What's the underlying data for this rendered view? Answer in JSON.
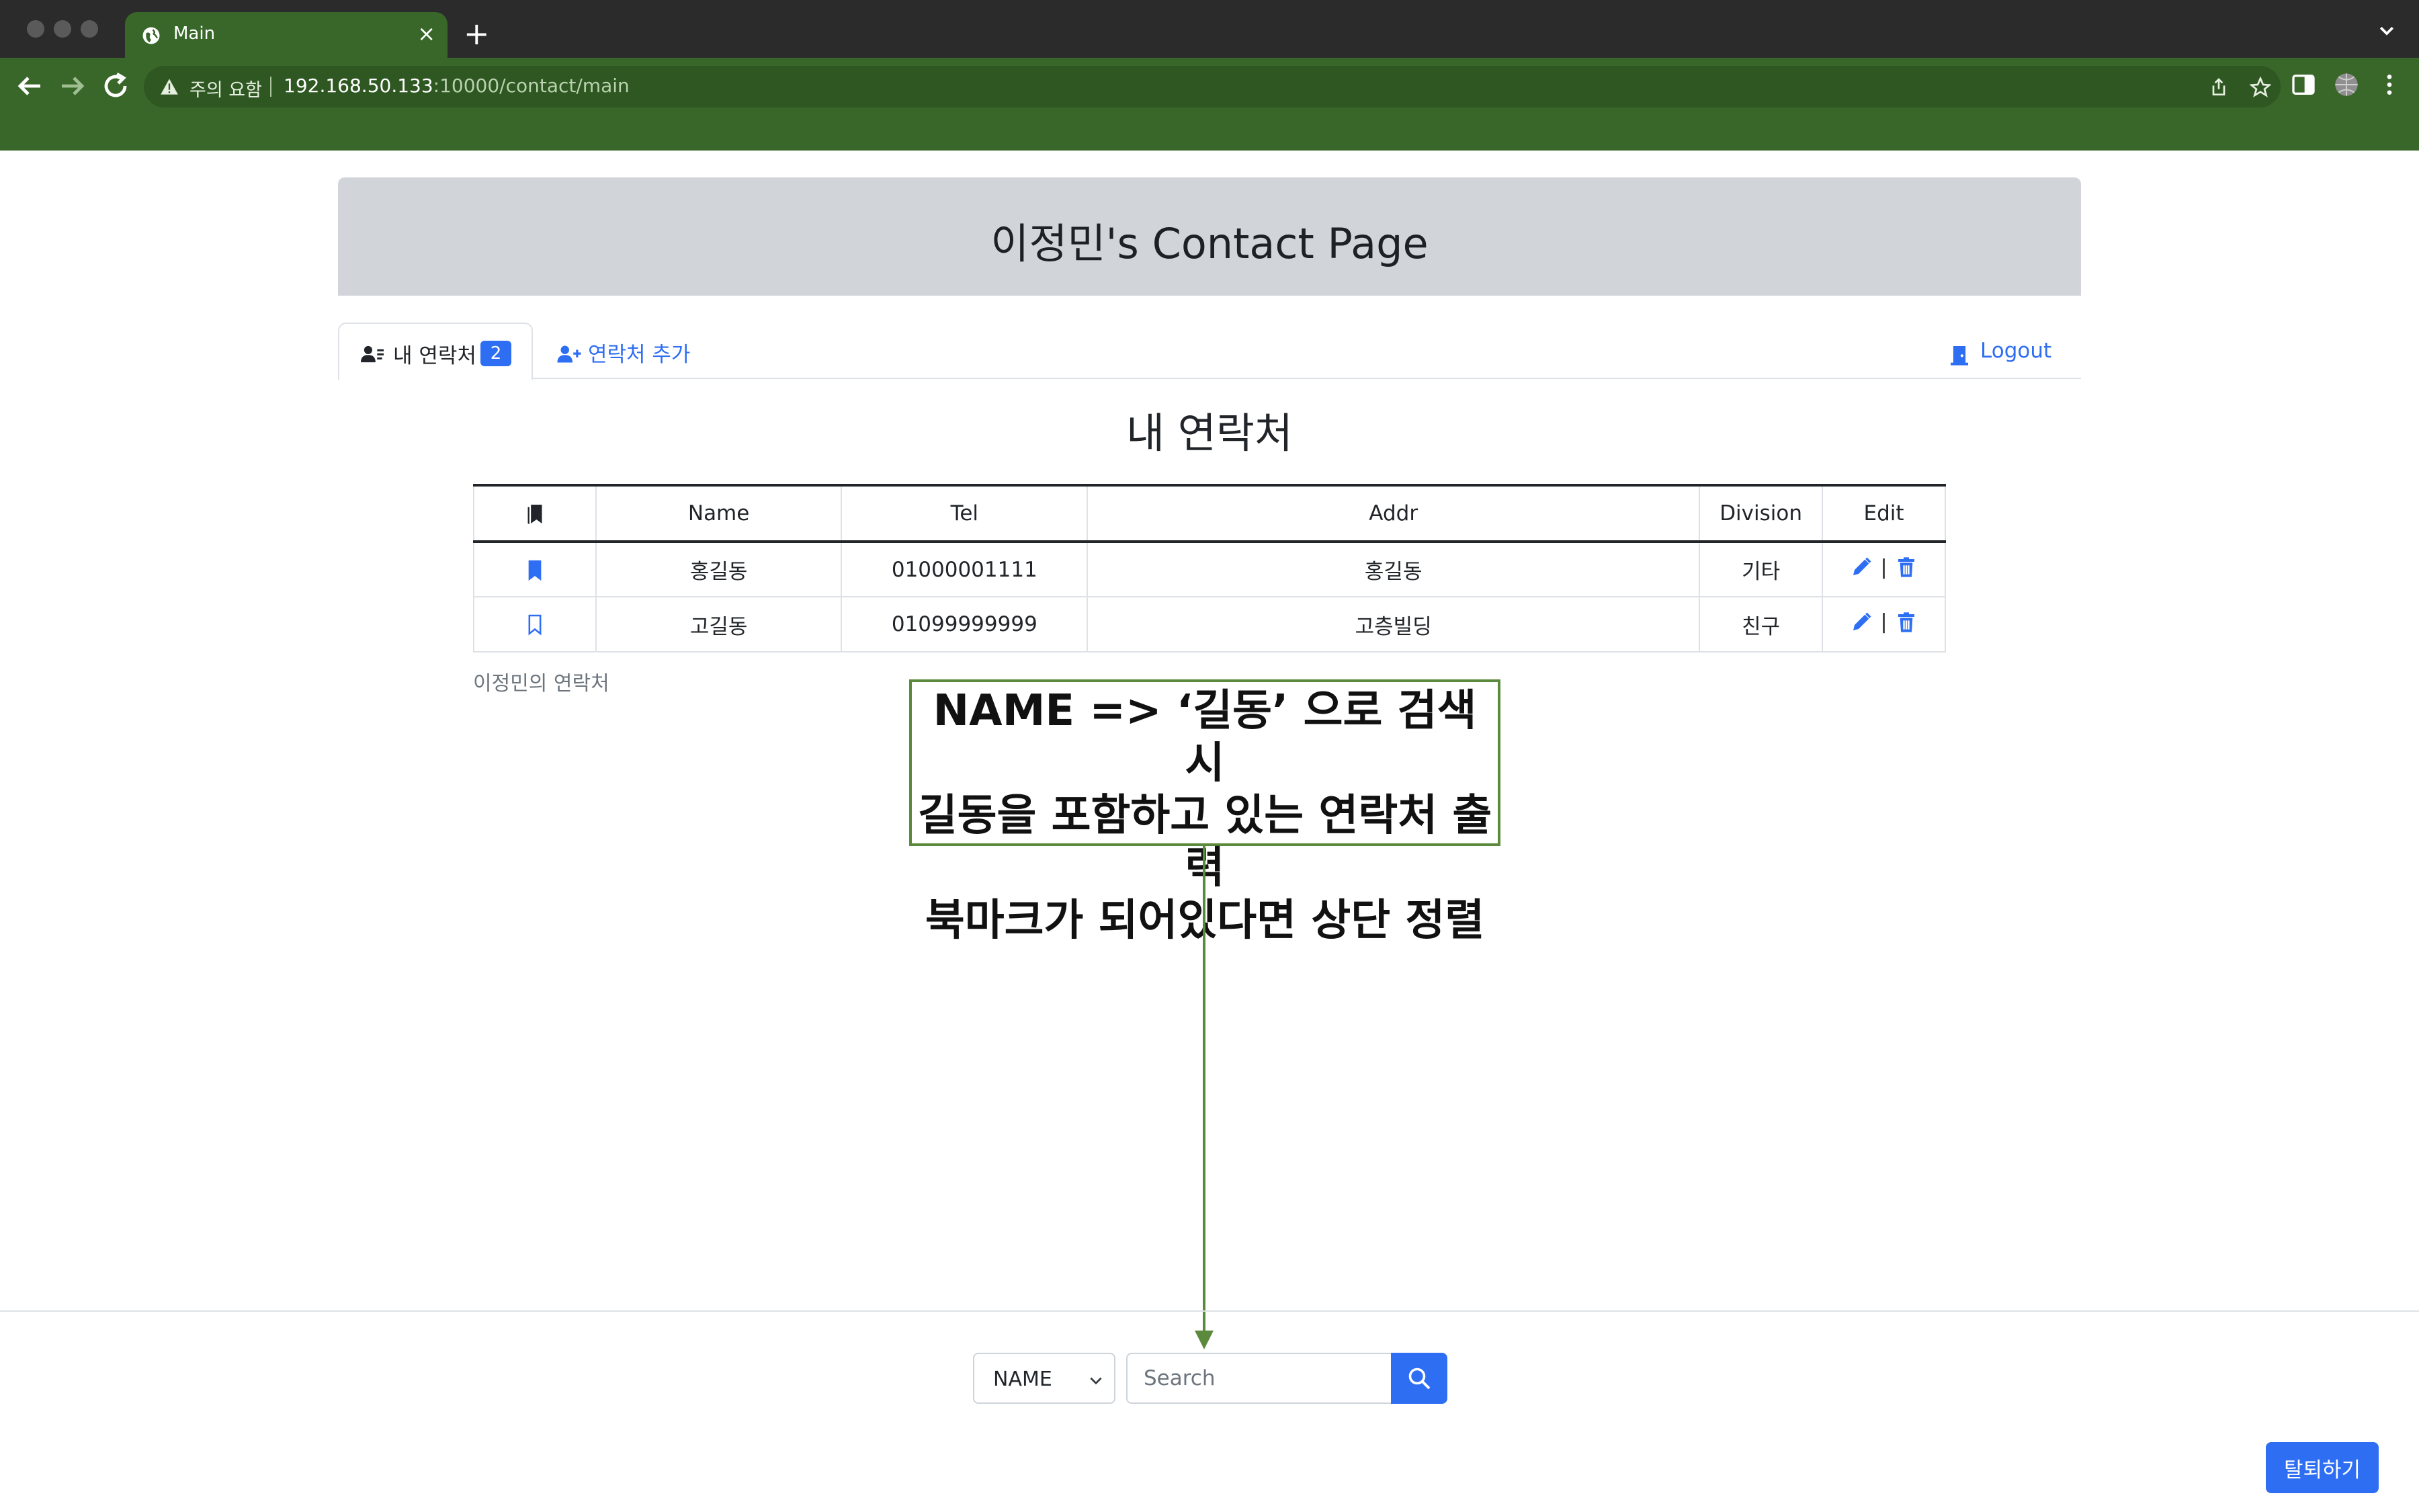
{
  "browser": {
    "tab_title": "Main",
    "new_tab": "+",
    "close_tab": "×",
    "security_warning": "주의 요함",
    "url_host": "192.168.50.133",
    "url_path": ":10000/contact/main"
  },
  "page": {
    "header_title": "이정민's Contact Page",
    "tabs": {
      "my_contacts": "내 연락처",
      "my_contacts_count": "2",
      "add_contact": "연락처 추가",
      "logout": "Logout"
    },
    "section_title": "내 연락처",
    "table": {
      "columns": [
        "",
        "Name",
        "Tel",
        "Addr",
        "Division",
        "Edit"
      ],
      "rows": [
        {
          "bookmarked": true,
          "name": "홍길동",
          "tel": "01000001111",
          "addr": "홍길동",
          "division": "기타"
        },
        {
          "bookmarked": false,
          "name": "고길동",
          "tel": "01099999999",
          "addr": "고층빌딩",
          "division": "친구"
        }
      ],
      "edit_separator": "|"
    },
    "caption": "이정민의 연락처",
    "search": {
      "field": "NAME",
      "placeholder": "Search"
    },
    "withdraw_button": "탈퇴하기"
  },
  "annotation": {
    "lines": [
      "NAME => ‘길동’ 으로 검색 시",
      "길동을 포함하고 있는 연락처 출력",
      "북마크가 되어있다면 상단 정렬"
    ]
  },
  "colors": {
    "chrome_green": "#386729",
    "accent_blue": "#2e6ef3",
    "annotation_green": "#5b8a3c",
    "header_gray": "#d1d5da"
  }
}
